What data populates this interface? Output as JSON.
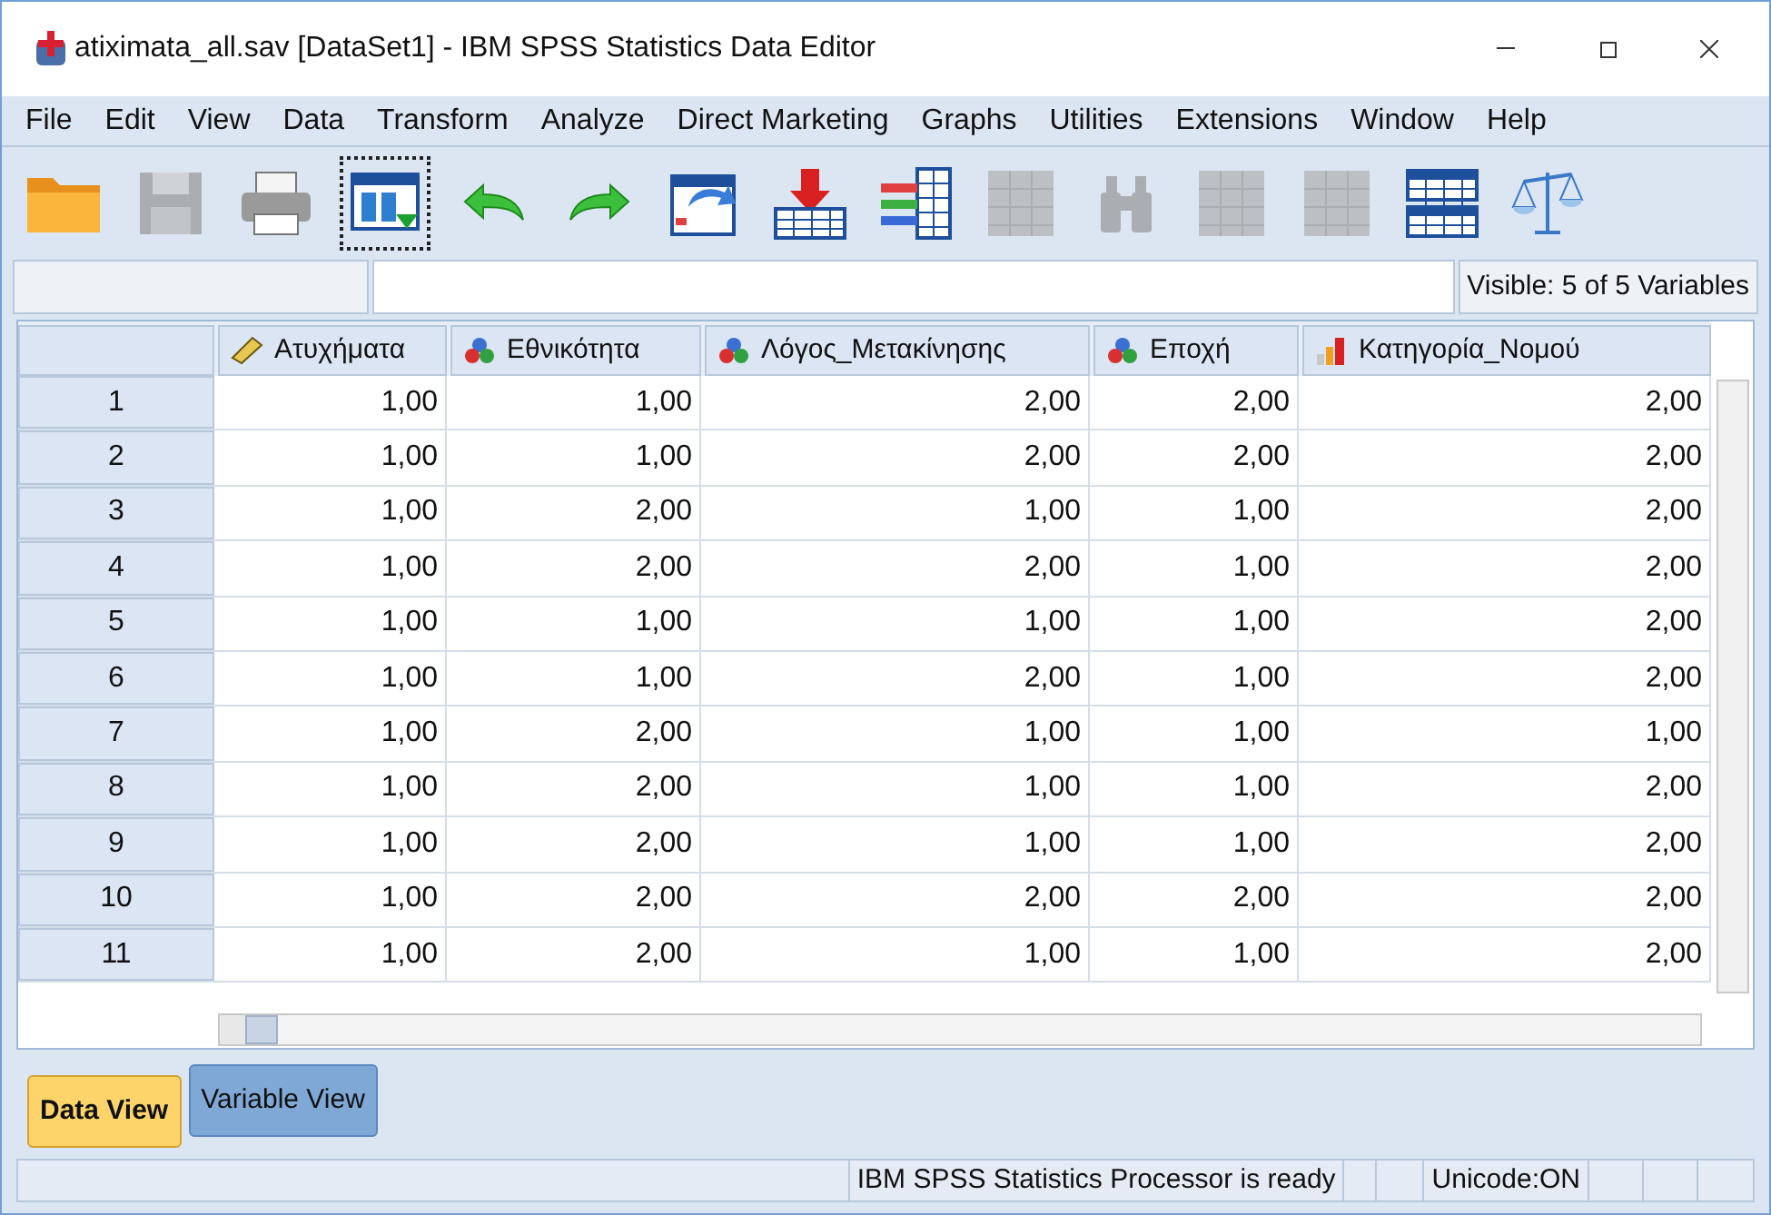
{
  "window": {
    "title": "atiximata_all.sav [DataSet1] - IBM SPSS Statistics Data Editor"
  },
  "menu": [
    "File",
    "Edit",
    "View",
    "Data",
    "Transform",
    "Analyze",
    "Direct Marketing",
    "Graphs",
    "Utilities",
    "Extensions",
    "Window",
    "Help"
  ],
  "toolbar": [
    {
      "kind": "folder",
      "disabled": false
    },
    {
      "kind": "disk",
      "disabled": true
    },
    {
      "kind": "printer",
      "disabled": false
    },
    {
      "kind": "dialog",
      "disabled": false,
      "selected": true
    },
    {
      "kind": "undo",
      "disabled": false
    },
    {
      "kind": "redo",
      "disabled": false
    },
    {
      "kind": "goto",
      "disabled": false
    },
    {
      "kind": "insert-row",
      "disabled": false
    },
    {
      "kind": "insert-col",
      "disabled": false
    },
    {
      "kind": "grid",
      "disabled": true
    },
    {
      "kind": "binoculars",
      "disabled": true
    },
    {
      "kind": "grid",
      "disabled": true
    },
    {
      "kind": "grid",
      "disabled": true
    },
    {
      "kind": "table",
      "disabled": false
    },
    {
      "kind": "scale",
      "disabled": false
    }
  ],
  "visible_label": "Visible: 5 of 5 Variables",
  "table": {
    "columns": [
      {
        "name": "Ατυχήματα",
        "kind": "scale"
      },
      {
        "name": "Εθνικότητα",
        "kind": "nominal"
      },
      {
        "name": "Λόγος_Μετακίνησης",
        "kind": "nominal"
      },
      {
        "name": "Εποχή",
        "kind": "nominal"
      },
      {
        "name": "Κατηγορία_Νομού",
        "kind": "ordinal"
      }
    ],
    "rows": [
      {
        "n": "1",
        "cells": [
          "1,00",
          "1,00",
          "2,00",
          "2,00",
          "2,00"
        ]
      },
      {
        "n": "2",
        "cells": [
          "1,00",
          "1,00",
          "2,00",
          "2,00",
          "2,00"
        ]
      },
      {
        "n": "3",
        "cells": [
          "1,00",
          "2,00",
          "1,00",
          "1,00",
          "2,00"
        ]
      },
      {
        "n": "4",
        "cells": [
          "1,00",
          "2,00",
          "2,00",
          "1,00",
          "2,00"
        ]
      },
      {
        "n": "5",
        "cells": [
          "1,00",
          "1,00",
          "1,00",
          "1,00",
          "2,00"
        ]
      },
      {
        "n": "6",
        "cells": [
          "1,00",
          "1,00",
          "2,00",
          "1,00",
          "2,00"
        ]
      },
      {
        "n": "7",
        "cells": [
          "1,00",
          "2,00",
          "1,00",
          "1,00",
          "1,00"
        ]
      },
      {
        "n": "8",
        "cells": [
          "1,00",
          "2,00",
          "1,00",
          "1,00",
          "2,00"
        ]
      },
      {
        "n": "9",
        "cells": [
          "1,00",
          "2,00",
          "1,00",
          "1,00",
          "2,00"
        ]
      },
      {
        "n": "10",
        "cells": [
          "1,00",
          "2,00",
          "2,00",
          "2,00",
          "2,00"
        ]
      },
      {
        "n": "11",
        "cells": [
          "1,00",
          "2,00",
          "1,00",
          "1,00",
          "2,00"
        ]
      }
    ]
  },
  "view_tabs": [
    {
      "label": "Data View",
      "selected": true
    },
    {
      "label": "Variable View",
      "selected": false
    }
  ],
  "status_bar": {
    "message": "IBM SPSS Statistics Processor is ready",
    "encoding": "Unicode:ON"
  }
}
